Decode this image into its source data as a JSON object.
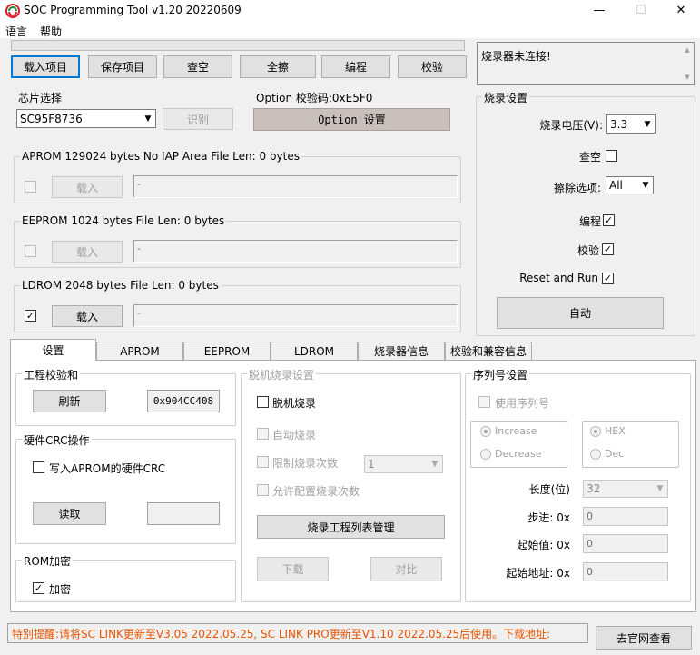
{
  "window": {
    "title": "SOC Programming Tool v1.20 20220609",
    "min": "—",
    "max": "☐",
    "close": "✕"
  },
  "menu": {
    "lang": "语言",
    "help": "帮助"
  },
  "toolbar": {
    "load": "载入项目",
    "save": "保存项目",
    "blank": "查空",
    "erase": "全擦",
    "program": "编程",
    "verify": "校验"
  },
  "message": "烧录器未连接!",
  "chip": {
    "group": "芯片选择",
    "selected": "SC95F8736",
    "identify": "识别"
  },
  "option": {
    "group": "Option  校验码:0xE5F0",
    "button": "Option 设置"
  },
  "aprom": {
    "group": "APROM 129024 bytes  No IAP Area    File Len: 0 bytes",
    "checked": false,
    "load": "载入",
    "path": "-"
  },
  "eeprom": {
    "group": "EEPROM 1024 bytes    File Len: 0 bytes",
    "checked": false,
    "load": "载入",
    "path": "-"
  },
  "ldrom": {
    "group": "LDROM 2048 bytes    File Len: 0 bytes",
    "checked": true,
    "load": "载入",
    "path": "-"
  },
  "burn": {
    "group": "烧录设置",
    "voltage_label": "烧录电压(V):",
    "voltage": "3.3",
    "blank_label": "查空",
    "erase_label": "擦除选项:",
    "erase_value": "All",
    "program_label": "编程",
    "verify_label": "校验",
    "reset_label": "Reset and Run",
    "auto": "自动"
  },
  "tabs": [
    "设置",
    "APROM",
    "EEPROM",
    "LDROM",
    "烧录器信息",
    "校验和兼容信息"
  ],
  "checksum": {
    "group": "工程校验和",
    "refresh": "刷新",
    "value": "0x904CC408"
  },
  "crc": {
    "group": "硬件CRC操作",
    "write_label": "写入APROM的硬件CRC",
    "read": "读取"
  },
  "rom": {
    "group": "ROM加密",
    "encrypt_label": "加密"
  },
  "offline": {
    "group": "脱机烧录设置",
    "offline_label": "脱机烧录",
    "auto_label": "自动烧录",
    "limit_label": "限制烧录次数",
    "limit_value": "1",
    "allow_label": "允许配置烧录次数",
    "manage": "烧录工程列表管理",
    "download": "下载",
    "compare": "对比"
  },
  "serial": {
    "group": "序列号设置",
    "use_label": "使用序列号",
    "increase": "Increase",
    "decrease": "Decrease",
    "hex": "HEX",
    "dec": "Dec",
    "length_label": "长度(位)",
    "length_value": "32",
    "step_label": "步进: 0x",
    "step_value": "0",
    "start_label": "起始值: 0x",
    "start_value": "0",
    "addr_label": "起始地址: 0x",
    "addr_value": "0"
  },
  "status": "特别提醒:请将SC LINK更新至V3.05 2022.05.25, SC LINK PRO更新至V1.10 2022.05.25后使用。下载地址:",
  "website": "去官网查看"
}
